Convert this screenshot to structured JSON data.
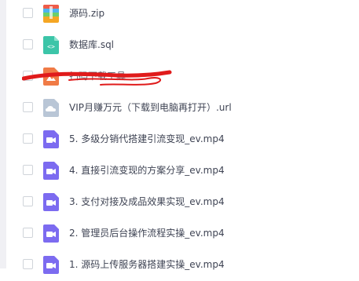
{
  "files": [
    {
      "name": "源码.zip",
      "icon": "zip-archive-icon",
      "icon_color": "#f5a623"
    },
    {
      "name": "数据库.sql",
      "icon": "code-file-icon",
      "icon_color": "#3cc5a8"
    },
    {
      "name": "扫码下载工具",
      "icon": "image-file-icon",
      "icon_color": "#f07b46"
    },
    {
      "name": "VIP月赚万元（下载到电脑再打开）.url",
      "icon": "cloud-link-icon",
      "icon_color": "#b9c6d6"
    },
    {
      "name": "5. 多级分销代搭建引流变现_ev.mp4",
      "icon": "video-file-icon",
      "icon_color": "#7c6bf0"
    },
    {
      "name": "4. 直接引流变现的方案分享_ev.mp4",
      "icon": "video-file-icon",
      "icon_color": "#7c6bf0"
    },
    {
      "name": "3. 支付对接及成品效果实现_ev.mp4",
      "icon": "video-file-icon",
      "icon_color": "#7c6bf0"
    },
    {
      "name": "2. 管理员后台操作流程实操_ev.mp4",
      "icon": "video-file-icon",
      "icon_color": "#7c6bf0"
    },
    {
      "name": "1. 源码上传服务器搭建实操_ev.mp4",
      "icon": "video-file-icon",
      "icon_color": "#7c6bf0"
    }
  ],
  "redaction_color": "#e01b1b"
}
